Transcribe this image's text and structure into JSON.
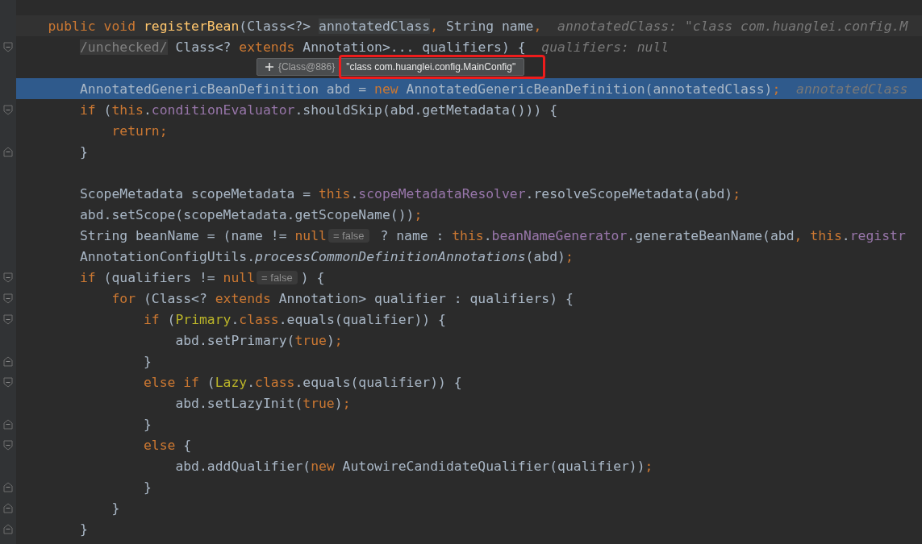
{
  "lines": [
    {
      "kind": "current",
      "fold_start": false,
      "fold_end": false,
      "tokens": [
        {
          "kind": "kw",
          "text": "    public void "
        },
        {
          "kind": "decl",
          "text": "registerBean"
        },
        {
          "kind": "plain",
          "text": "(Class<?> "
        },
        {
          "kind": "usage",
          "text": "annotatedClass"
        },
        {
          "kind": "kw",
          "text": ","
        },
        {
          "kind": "plain",
          "text": " String name"
        },
        {
          "kind": "kw",
          "text": ","
        },
        {
          "kind": "hint",
          "text": "annotatedClass: \"class com.huanglei.config.M"
        }
      ]
    },
    {
      "kind": "plain",
      "fold_start": true,
      "fold_end": false,
      "tokens": [
        {
          "kind": "placeholder",
          "text": "        /unchecked/"
        },
        {
          "kind": "plain",
          "text": " Class<? "
        },
        {
          "kind": "kw",
          "text": "extends"
        },
        {
          "kind": "plain",
          "text": " Annotation>... qualifiers) {"
        },
        {
          "kind": "hint",
          "text": "qualifiers: null"
        }
      ]
    },
    {
      "kind": "plain",
      "fold_start": false,
      "fold_end": false
    },
    {
      "kind": "execution",
      "fold_start": false,
      "fold_end": false,
      "tokens": [
        {
          "kind": "plain",
          "text": "        AnnotatedGenericBeanDefinition abd = "
        },
        {
          "kind": "kw",
          "text": "new"
        },
        {
          "kind": "plain",
          "text": " AnnotatedGenericBeanDefinition(annotatedClass)"
        },
        {
          "kind": "kw",
          "text": ";"
        },
        {
          "kind": "hint",
          "text": "annotatedClass"
        }
      ]
    },
    {
      "kind": "plain",
      "fold_start": true,
      "fold_end": false,
      "tokens": [
        {
          "kind": "kw",
          "text": "        if"
        },
        {
          "kind": "plain",
          "text": " ("
        },
        {
          "kind": "kw",
          "text": "this"
        },
        {
          "kind": "plain",
          "text": "."
        },
        {
          "kind": "field",
          "text": "conditionEvaluator"
        },
        {
          "kind": "plain",
          "text": ".shouldSkip(abd.getMetadata())) {"
        }
      ]
    },
    {
      "kind": "plain",
      "fold_start": false,
      "fold_end": false,
      "tokens": [
        {
          "kind": "kw",
          "text": "            return;"
        }
      ]
    },
    {
      "kind": "plain",
      "fold_start": false,
      "fold_end": true,
      "tokens": [
        {
          "kind": "plain",
          "text": "        }"
        }
      ]
    },
    {
      "kind": "plain",
      "fold_start": false,
      "fold_end": false
    },
    {
      "kind": "plain",
      "fold_start": false,
      "fold_end": false,
      "tokens": [
        {
          "kind": "plain",
          "text": "        ScopeMetadata scopeMetadata = "
        },
        {
          "kind": "kw",
          "text": "this"
        },
        {
          "kind": "plain",
          "text": "."
        },
        {
          "kind": "field",
          "text": "scopeMetadataResolver"
        },
        {
          "kind": "plain",
          "text": ".resolveScopeMetadata(abd)"
        },
        {
          "kind": "kw",
          "text": ";"
        }
      ]
    },
    {
      "kind": "plain",
      "fold_start": false,
      "fold_end": false,
      "tokens": [
        {
          "kind": "plain",
          "text": "        abd.setScope(scopeMetadata.getScopeName())"
        },
        {
          "kind": "kw",
          "text": ";"
        }
      ]
    },
    {
      "kind": "plain",
      "fold_start": false,
      "fold_end": false,
      "tokens": [
        {
          "kind": "plain",
          "text": "        String beanName = (name != "
        },
        {
          "kind": "kw",
          "text": "null"
        },
        {
          "kind": "inlay",
          "text": "= false"
        },
        {
          "kind": "plain",
          "text": " ? name : "
        },
        {
          "kind": "kw",
          "text": "this"
        },
        {
          "kind": "plain",
          "text": "."
        },
        {
          "kind": "field",
          "text": "beanNameGenerator"
        },
        {
          "kind": "plain",
          "text": ".generateBeanName(abd"
        },
        {
          "kind": "kw",
          "text": ", this"
        },
        {
          "kind": "plain",
          "text": "."
        },
        {
          "kind": "field",
          "text": "registr"
        }
      ]
    },
    {
      "kind": "plain",
      "fold_start": false,
      "fold_end": false,
      "tokens": [
        {
          "kind": "plain",
          "text": "        AnnotationConfigUtils."
        },
        {
          "kind": "static",
          "text": "processCommonDefinitionAnnotations"
        },
        {
          "kind": "plain",
          "text": "(abd)"
        },
        {
          "kind": "kw",
          "text": ";"
        }
      ]
    },
    {
      "kind": "plain",
      "fold_start": true,
      "fold_end": false,
      "tokens": [
        {
          "kind": "kw",
          "text": "        if"
        },
        {
          "kind": "plain",
          "text": " (qualifiers != "
        },
        {
          "kind": "kw",
          "text": "null"
        },
        {
          "kind": "inlay",
          "text": "= false"
        },
        {
          "kind": "plain",
          "text": ") {"
        }
      ]
    },
    {
      "kind": "plain",
      "fold_start": true,
      "fold_end": false,
      "tokens": [
        {
          "kind": "kw",
          "text": "            for"
        },
        {
          "kind": "plain",
          "text": " (Class<? "
        },
        {
          "kind": "kw",
          "text": "extends"
        },
        {
          "kind": "plain",
          "text": " Annotation> qualifier : qualifiers) {"
        }
      ]
    },
    {
      "kind": "plain",
      "fold_start": true,
      "fold_end": false,
      "tokens": [
        {
          "kind": "kw",
          "text": "                if"
        },
        {
          "kind": "plain",
          "text": " ("
        },
        {
          "kind": "annot",
          "text": "Primary"
        },
        {
          "kind": "plain",
          "text": "."
        },
        {
          "kind": "kw",
          "text": "class"
        },
        {
          "kind": "plain",
          "text": ".equals(qualifier)) {"
        }
      ]
    },
    {
      "kind": "plain",
      "fold_start": false,
      "fold_end": false,
      "tokens": [
        {
          "kind": "plain",
          "text": "                    abd.setPrimary("
        },
        {
          "kind": "kw",
          "text": "true"
        },
        {
          "kind": "plain",
          "text": ")"
        },
        {
          "kind": "kw",
          "text": ";"
        }
      ]
    },
    {
      "kind": "plain",
      "fold_start": false,
      "fold_end": true,
      "tokens": [
        {
          "kind": "plain",
          "text": "                }"
        }
      ]
    },
    {
      "kind": "plain",
      "fold_start": true,
      "fold_end": false,
      "tokens": [
        {
          "kind": "kw",
          "text": "                else if"
        },
        {
          "kind": "plain",
          "text": " ("
        },
        {
          "kind": "annot",
          "text": "Lazy"
        },
        {
          "kind": "plain",
          "text": "."
        },
        {
          "kind": "kw",
          "text": "class"
        },
        {
          "kind": "plain",
          "text": ".equals(qualifier)) {"
        }
      ]
    },
    {
      "kind": "plain",
      "fold_start": false,
      "fold_end": false,
      "tokens": [
        {
          "kind": "plain",
          "text": "                    abd.setLazyInit("
        },
        {
          "kind": "kw",
          "text": "true"
        },
        {
          "kind": "plain",
          "text": ")"
        },
        {
          "kind": "kw",
          "text": ";"
        }
      ]
    },
    {
      "kind": "plain",
      "fold_start": false,
      "fold_end": true,
      "tokens": [
        {
          "kind": "plain",
          "text": "                }"
        }
      ]
    },
    {
      "kind": "plain",
      "fold_start": true,
      "fold_end": false,
      "tokens": [
        {
          "kind": "kw",
          "text": "                else"
        },
        {
          "kind": "plain",
          "text": " {"
        }
      ]
    },
    {
      "kind": "plain",
      "fold_start": false,
      "fold_end": false,
      "tokens": [
        {
          "kind": "plain",
          "text": "                    abd.addQualifier("
        },
        {
          "kind": "kw",
          "text": "new"
        },
        {
          "kind": "plain",
          "text": " AutowireCandidateQualifier(qualifier))"
        },
        {
          "kind": "kw",
          "text": ";"
        }
      ]
    },
    {
      "kind": "plain",
      "fold_start": false,
      "fold_end": true,
      "tokens": [
        {
          "kind": "plain",
          "text": "                }"
        }
      ]
    },
    {
      "kind": "plain",
      "fold_start": false,
      "fold_end": true,
      "tokens": [
        {
          "kind": "plain",
          "text": "            }"
        }
      ]
    },
    {
      "kind": "plain",
      "fold_start": false,
      "fold_end": true,
      "tokens": [
        {
          "kind": "plain",
          "text": "        }"
        }
      ]
    }
  ],
  "tooltip": {
    "object_id": "{Class@886}",
    "value": "\"class com.huanglei.config.MainConfig\"",
    "outlined": true
  }
}
